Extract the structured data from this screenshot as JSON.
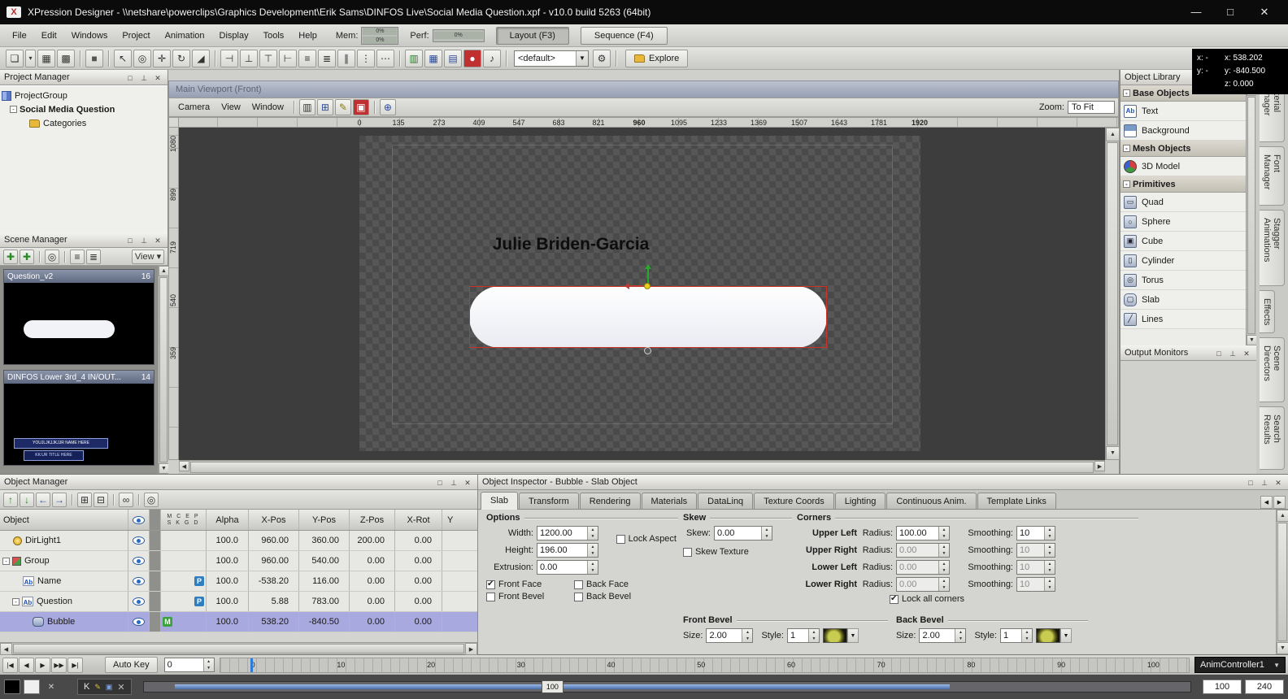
{
  "window": {
    "title": "XPression Designer - \\\\netshare\\powerclips\\Graphics Development\\Erik Sams\\DINFOS Live\\Social Media Question.xpf - v10.0 build 5263 (64bit)"
  },
  "menu_bar": {
    "items": [
      "File",
      "Edit",
      "Windows",
      "Project",
      "Animation",
      "Display",
      "Tools",
      "Help"
    ],
    "mem_label": "Mem:",
    "mem_top": "0%",
    "mem_bottom": "0%",
    "perf_label": "Perf:",
    "perf_value": "0%",
    "layout_btn": "Layout (F3)",
    "sequence_btn": "Sequence (F4)"
  },
  "status_coords": {
    "x_left": "x: -",
    "y_left": "y: -",
    "x_right": "x: 538.202",
    "y_right": "y: -840.500",
    "z_right": "z: 0.000"
  },
  "toolbar": {
    "preset_value": "<default>",
    "explore_label": "Explore"
  },
  "project_manager": {
    "title": "Project Manager",
    "root": "ProjectGroup",
    "project": "Social Media Question",
    "child": "Categories"
  },
  "scene_manager": {
    "title": "Scene Manager",
    "view_label": "View",
    "scenes": [
      {
        "name": "Question_v2",
        "id": "16"
      },
      {
        "name": "DINFOS Lower 3rd_4  IN/OUT...",
        "id": "14"
      }
    ],
    "thumb_caption_1": "YOUJLJKJJKJJR NAME HERE",
    "thumb_caption_2": "KK:UR TITLE HERE"
  },
  "viewport": {
    "title": "Main Viewport (Front)",
    "menus": [
      "Camera",
      "View",
      "Window"
    ],
    "zoom_label": "Zoom:",
    "zoom_value": "To Fit",
    "hruler": [
      "0",
      "135",
      "273",
      "409",
      "547",
      "683",
      "821",
      "960",
      "1095",
      "1233",
      "1369",
      "1507",
      "1643",
      "1781",
      "1920"
    ],
    "vruler": [
      "1080",
      "899",
      "719",
      "540",
      "359"
    ],
    "scene_text": "Julie Briden-Garcia"
  },
  "object_library": {
    "title": "Object Library",
    "section_base": "Base Objects",
    "section_mesh": "Mesh Objects",
    "section_prim": "Primitives",
    "base_items": [
      "Text",
      "Background"
    ],
    "mesh_items": [
      "3D Model"
    ],
    "primitive_items": [
      "Quad",
      "Sphere",
      "Cube",
      "Cylinder",
      "Torus",
      "Slab",
      "Lines"
    ]
  },
  "output_monitors": {
    "title": "Output Monitors"
  },
  "side_tabs": [
    "Material Manager",
    "Font Manager",
    "Stagger Animations",
    "Effects",
    "Scene Directors",
    "Search Results"
  ],
  "object_manager": {
    "title": "Object Manager",
    "col_object": "Object",
    "badge_header_top": "MCEP",
    "badge_header_bottom": "SKGD",
    "col_alpha": "Alpha",
    "col_xpos": "X-Pos",
    "col_ypos": "Y-Pos",
    "col_zpos": "Z-Pos",
    "col_xrot": "X-Rot",
    "col_y": "Y",
    "rows": [
      {
        "name": "DirLight1",
        "badge": "",
        "alpha": "100.0",
        "xpos": "960.00",
        "ypos": "360.00",
        "zpos": "200.00",
        "xrot": "0.00"
      },
      {
        "name": "Group",
        "badge": "",
        "alpha": "100.0",
        "xpos": "960.00",
        "ypos": "540.00",
        "zpos": "0.00",
        "xrot": "0.00"
      },
      {
        "name": "Name",
        "badge": "P",
        "alpha": "100.0",
        "xpos": "-538.20",
        "ypos": "116.00",
        "zpos": "0.00",
        "xrot": "0.00"
      },
      {
        "name": "Question",
        "badge": "P",
        "alpha": "100.0",
        "xpos": "5.88",
        "ypos": "783.00",
        "zpos": "0.00",
        "xrot": "0.00"
      },
      {
        "name": "Bubble",
        "badge": "M",
        "alpha": "100.0",
        "xpos": "538.20",
        "ypos": "-840.50",
        "zpos": "0.00",
        "xrot": "0.00"
      }
    ]
  },
  "object_inspector": {
    "title": "Object Inspector - Bubble - Slab Object",
    "tabs": [
      "Slab",
      "Transform",
      "Rendering",
      "Materials",
      "DataLinq",
      "Texture Coords",
      "Lighting",
      "Continuous Anim.",
      "Template Links"
    ],
    "options": {
      "header": "Options",
      "width_label": "Width:",
      "width_value": "1200.00",
      "height_label": "Height:",
      "height_value": "196.00",
      "extrusion_label": "Extrusion:",
      "extrusion_value": "0.00",
      "lock_aspect_label": "Lock Aspect",
      "front_face_label": "Front Face",
      "back_face_label": "Back Face",
      "front_bevel_label": "Front Bevel",
      "back_bevel_label": "Back Bevel"
    },
    "skew": {
      "header": "Skew",
      "skew_label": "Skew:",
      "skew_value": "0.00",
      "skew_texture_label": "Skew Texture"
    },
    "corners": {
      "header": "Corners",
      "radius_label": "Radius:",
      "smoothing_label": "Smoothing:",
      "rows": [
        {
          "label": "Upper Left",
          "radius": "100.00",
          "smoothing": "10"
        },
        {
          "label": "Upper Right",
          "radius": "0.00",
          "smoothing": "10"
        },
        {
          "label": "Lower Left",
          "radius": "0.00",
          "smoothing": "10"
        },
        {
          "label": "Lower Right",
          "radius": "0.00",
          "smoothing": "10"
        }
      ],
      "lock_all_label": "Lock all corners"
    },
    "front_bevel": {
      "header": "Front Bevel",
      "size_label": "Size:",
      "size_value": "2.00",
      "style_label": "Style:",
      "style_value": "1"
    },
    "back_bevel": {
      "header": "Back Bevel",
      "size_label": "Size:",
      "size_value": "2.00",
      "style_label": "Style:",
      "style_value": "1"
    }
  },
  "timeline": {
    "auto_key_label": "Auto Key",
    "frame_value": "0",
    "ticks": [
      "0",
      "10",
      "20",
      "30",
      "40",
      "50",
      "60",
      "70",
      "80",
      "90",
      "100"
    ],
    "controller": "AnimController1",
    "position_value": "100",
    "in_value": "100",
    "out_value": "240"
  },
  "dock_strip": {
    "k_label": "K"
  }
}
